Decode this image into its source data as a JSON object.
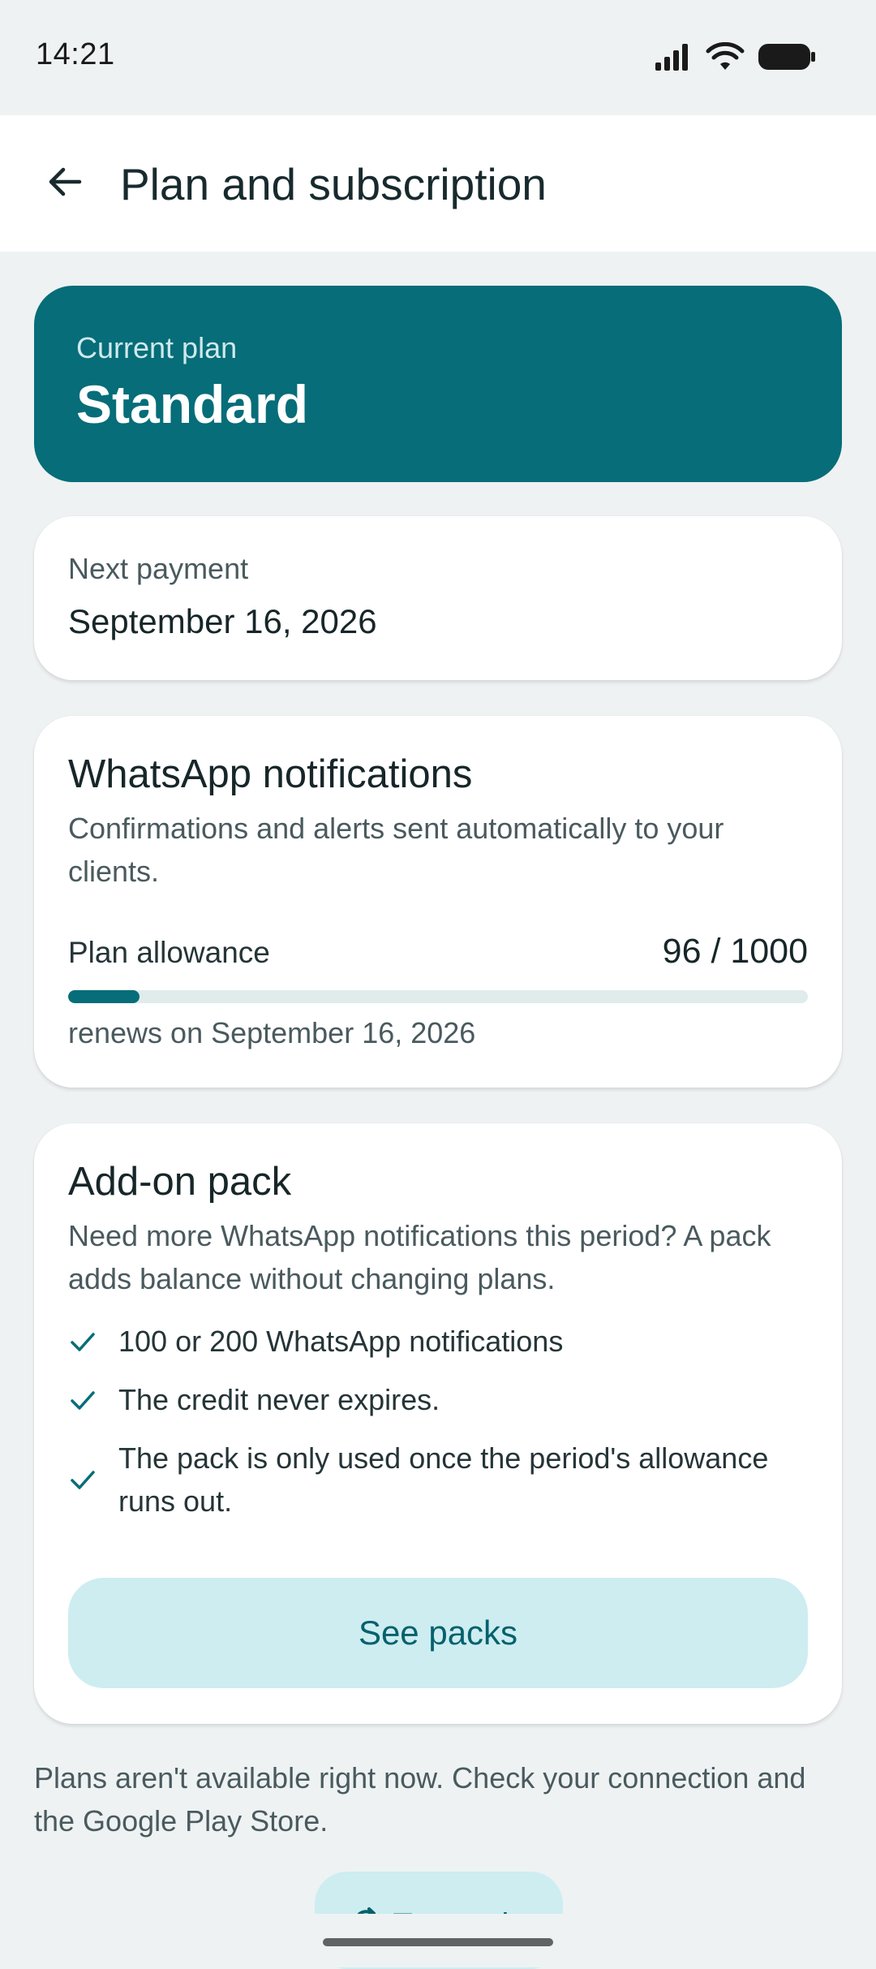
{
  "status_bar": {
    "time": "14:21",
    "icons": [
      "signal-icon",
      "wifi-icon",
      "battery-icon"
    ]
  },
  "app_bar": {
    "back_icon": "arrow-left-icon",
    "title": "Plan and subscription"
  },
  "current_plan": {
    "label": "Current plan",
    "value": "Standard"
  },
  "next_payment": {
    "label": "Next payment",
    "value": "September 16, 2026"
  },
  "whatsapp": {
    "title": "WhatsApp notifications",
    "description": "Confirmations and alerts sent automatically to your clients.",
    "allowance_label": "Plan allowance",
    "allowance_text": "96 / 1000",
    "used": 96,
    "total": 1000,
    "renews": "renews on September 16, 2026"
  },
  "addon": {
    "title": "Add-on pack",
    "description": "Need more WhatsApp notifications this period? A pack adds balance without changing plans.",
    "benefits": [
      "100 or 200 WhatsApp notifications",
      "The credit never expires.",
      "The pack is only used once the period's allowance runs out."
    ],
    "cta": "See packs"
  },
  "footer": {
    "message": "Plans aren't available right now. Check your connection and the Google Play Store.",
    "retry_label": "Try again",
    "retry_icon": "refresh-icon"
  },
  "colors": {
    "accent": "#066D79",
    "accent_soft": "#CDEDF1",
    "background": "#EEF2F3"
  }
}
